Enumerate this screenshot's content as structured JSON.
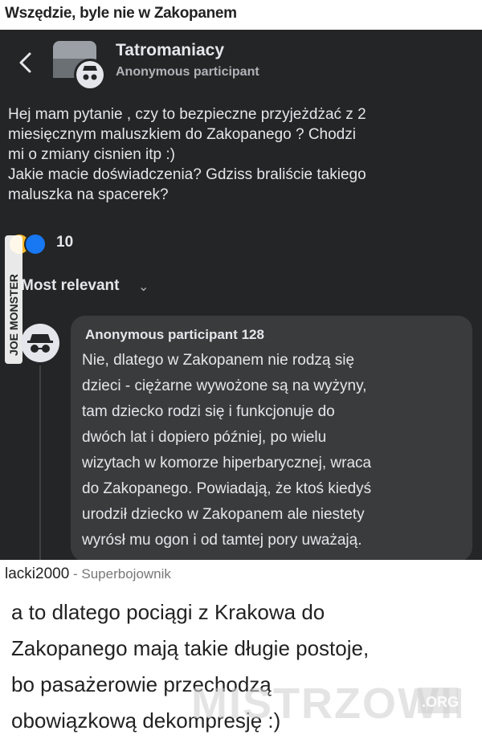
{
  "page": {
    "title": "Wszędzie, byle nie w Zakopanem"
  },
  "post": {
    "group_name": "Tatromaniacy",
    "poster": "Anonymous participant",
    "text_lines": [
      "Hej mam pytanie , czy to bezpieczne przyjeżdżać z 2",
      "miesięcznym  maluszkiem do Zakopanego ? Chodzi",
      "mi o zmiany cisnien itp :)",
      "Jakie macie doświadczenia? Gdziss braliście takiego",
      "maluszka na spacerek?"
    ],
    "reaction_count": "10",
    "sort_label": "Most relevant"
  },
  "side_watermark": "JOE MONSTER",
  "comment": {
    "author": "Anonymous participant 128",
    "lines": [
      "Nie, dlatego w Zakopanem nie rodzą się",
      "dzieci - ciężarne wywożone są na wyżyny,",
      "tam dziecko rodzi się i funkcjonuje do",
      "dwóch lat i dopiero później, po wielu",
      "wizytach w komorze hiperbarycznej, wraca",
      "do Zakopanego. Powiadają, że ktoś kiedyś",
      "urodził dziecko w Zakopanem ale niestety",
      "wyrósł mu ogon i od tamtej pory uważają."
    ]
  },
  "answer": {
    "username": "lacki2000",
    "rank": " - Superbojownik",
    "lines": [
      "a to dlatego pociągi z Krakowa do",
      "Zakopanego mają takie długie postoje,",
      "bo pasażerowie przechodzą",
      "obowiązkową dekompresję :)"
    ]
  },
  "brand_watermark": {
    "name": "MISTRZOWIE",
    "tld": ".ORG"
  },
  "colors": {
    "screen_bg": "#242526",
    "bubble_bg": "#3a3b3c",
    "text_light": "#e4e6eb",
    "like_blue": "#1877f2",
    "haha_yellow": "#f7b928"
  }
}
